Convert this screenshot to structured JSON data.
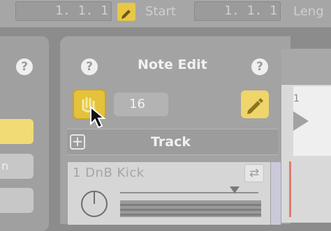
{
  "toolbar": {
    "position_value": "1. 1. 1",
    "start_label": "Start",
    "start_value": "1. 1. 1",
    "length_label": "Leng"
  },
  "note_edit": {
    "title": "Note Edit",
    "help_glyph": "?",
    "quantize_value": "16",
    "draw_mode_icon": "pencil-icon"
  },
  "track_section": {
    "title": "Track",
    "add_glyph": "+",
    "track_name": "1 DnB Kick",
    "swap_glyph": "⇄"
  },
  "timeline": {
    "bar_marker": "1"
  },
  "colors": {
    "accent_yellow": "#e4c23a",
    "panel_gray": "#a3a3a3",
    "light_gray": "#d6d6d6",
    "playhead_red": "#e07a6c"
  }
}
